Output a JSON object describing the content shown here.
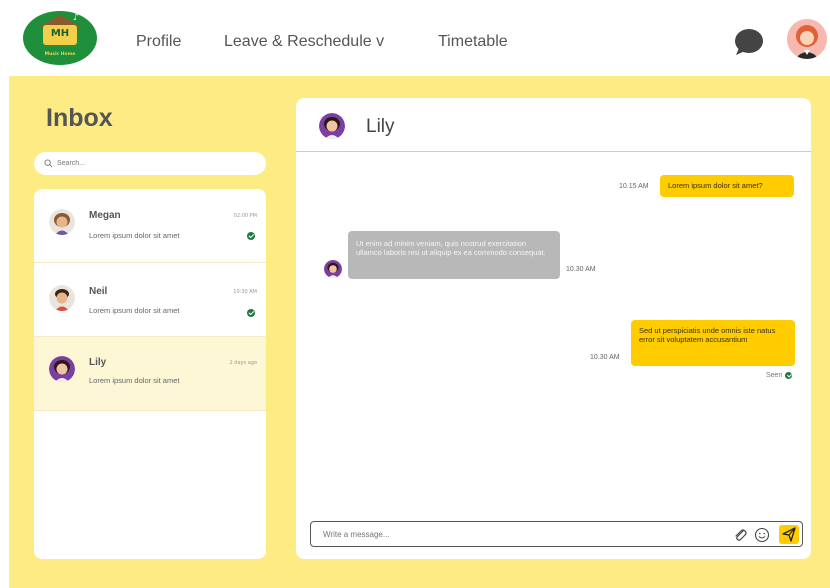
{
  "logo": {
    "initials": "MH",
    "name": "Music Home"
  },
  "nav": {
    "profile": "Profile",
    "leave": "Leave & Reschedule v",
    "timetable": "Timetable"
  },
  "inbox": {
    "title": "Inbox",
    "search_placeholder": "Search..."
  },
  "conversations": [
    {
      "name": "Megan",
      "time": "02:00 PM",
      "preview": "Lorem ipsum dolor sit amet",
      "read": true
    },
    {
      "name": "Neil",
      "time": "10:30 AM",
      "preview": "Lorem ipsum dolor sit amet",
      "read": true
    },
    {
      "name": "Lily",
      "time": "2 days ago",
      "preview": "Lorem ipsum dolor sit amet",
      "read": false,
      "active": true
    }
  ],
  "chat": {
    "contact_name": "Lily",
    "messages": [
      {
        "direction": "out",
        "time": "10.15 AM",
        "text": "Lorem ipsum dolor sit amet?"
      },
      {
        "direction": "in",
        "time": "10.30 AM",
        "text": "Ut enim ad minim veniam, quis nostrud exercitation ullamco laboris nisi ut aliquip ex ea commodo consequat."
      },
      {
        "direction": "out",
        "time": "10.30 AM",
        "text": "Sed ut perspiciatis unde omnis iste natus error sit voluptatem accusantium"
      }
    ],
    "seen_label": "Seen",
    "composer_placeholder": "Write a message..."
  },
  "colors": {
    "brand_yellow": "#fdeb83",
    "bubble_out": "#ffcc00",
    "bubble_in": "#b8b8b8",
    "logo_green": "#1f8f3c",
    "check_green": "#1e7a3c"
  }
}
